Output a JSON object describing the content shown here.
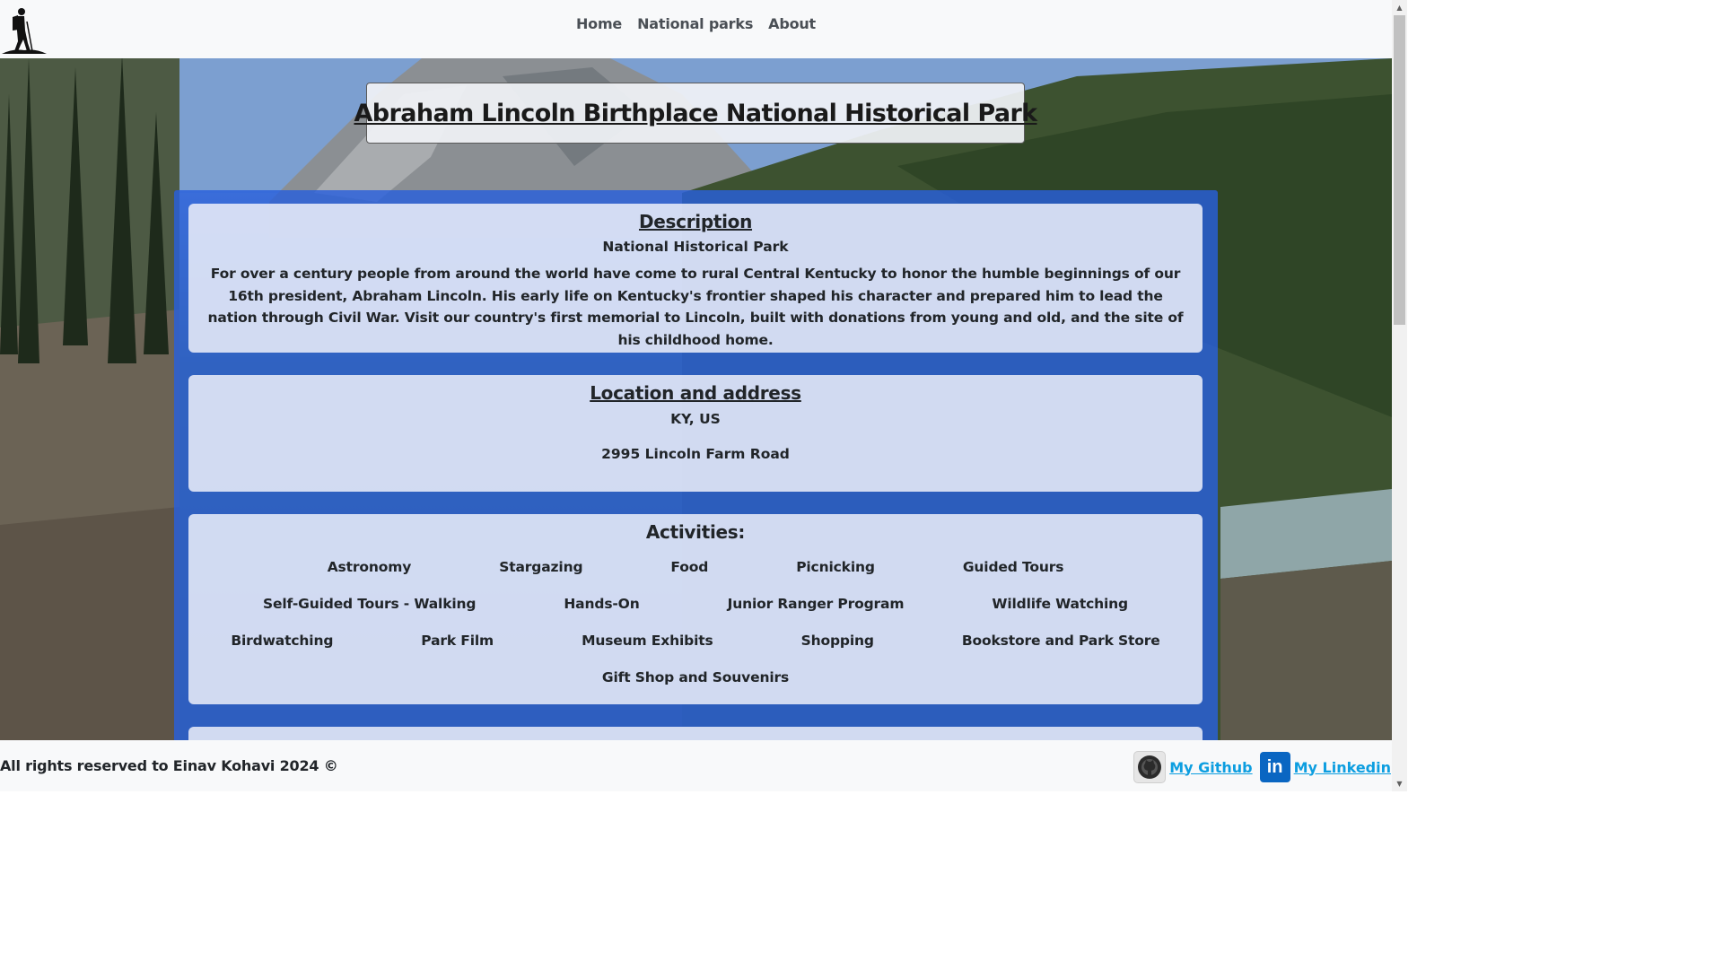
{
  "nav": {
    "items": [
      {
        "label": "Home"
      },
      {
        "label": "National parks"
      },
      {
        "label": "About"
      }
    ]
  },
  "park": {
    "title": "Abraham Lincoln Birthplace National Historical Park",
    "description_heading": "Description",
    "designation": "National Historical Park",
    "description": "For over a century people from around the world have come to rural Central Kentucky to honor the humble beginnings of our 16th president, Abraham Lincoln. His early life on Kentucky's frontier shaped his character and prepared him to lead the nation through Civil War. Visit our country's first memorial to Lincoln, built with donations from young and old, and the site of his childhood home.",
    "location_heading": "Location and address",
    "state_country": "KY, US",
    "address": "2995 Lincoln Farm Road",
    "activities_heading": "Activities:",
    "activity_rows": [
      [
        "Astronomy",
        "Stargazing",
        "Food",
        "Picnicking",
        "Guided Tours"
      ],
      [
        "Self-Guided Tours - Walking",
        "Hands-On",
        "Junior Ranger Program",
        "Wildlife Watching"
      ],
      [
        "Birdwatching",
        "Park Film",
        "Museum Exhibits",
        "Shopping",
        "Bookstore and Park Store"
      ],
      [
        "Gift Shop and Souvenirs"
      ]
    ]
  },
  "footer": {
    "copyright": "All rights reserved to Einav Kohavi 2024 ©",
    "github_label": "My Github",
    "linkedin_label": "My Linkedin",
    "linkedin_icon_text": "in"
  },
  "colors": {
    "panel_blue": "#285fdc",
    "link_blue": "#0d9ee0",
    "linkedin_blue": "#0a66c2"
  }
}
